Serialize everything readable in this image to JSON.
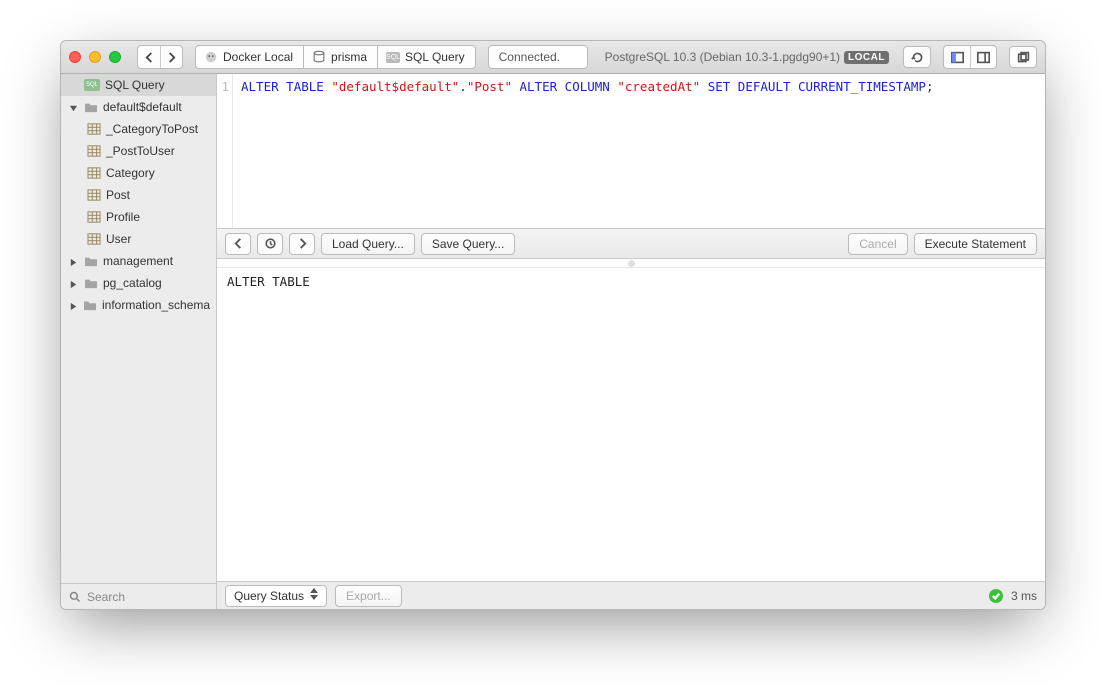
{
  "titlebar": {
    "connection_status": "Connected.",
    "db_version_prefix": "PostgreSQL 10.3 (Debian 10.3-1.pgdg90+1)",
    "local_badge": "LOCAL"
  },
  "breadcrumbs": [
    {
      "icon": "elephant",
      "label": "Docker Local"
    },
    {
      "icon": "db",
      "label": "prisma"
    },
    {
      "icon": "sql",
      "label": "SQL Query"
    }
  ],
  "sidebar": {
    "search_placeholder": "Search",
    "items": [
      {
        "kind": "sql",
        "label": "SQL Query",
        "depth": 1,
        "selected": true,
        "expandable": false
      },
      {
        "kind": "folder",
        "label": "default$default",
        "depth": 1,
        "selected": false,
        "expandable": true,
        "expanded": true
      },
      {
        "kind": "table",
        "label": "_CategoryToPost",
        "depth": 2
      },
      {
        "kind": "table",
        "label": "_PostToUser",
        "depth": 2
      },
      {
        "kind": "table",
        "label": "Category",
        "depth": 2
      },
      {
        "kind": "table",
        "label": "Post",
        "depth": 2
      },
      {
        "kind": "table",
        "label": "Profile",
        "depth": 2
      },
      {
        "kind": "table",
        "label": "User",
        "depth": 2
      },
      {
        "kind": "folder",
        "label": "management",
        "depth": 1,
        "expandable": true,
        "expanded": false
      },
      {
        "kind": "folder",
        "label": "pg_catalog",
        "depth": 1,
        "expandable": true,
        "expanded": false
      },
      {
        "kind": "folder",
        "label": "information_schema",
        "depth": 1,
        "expandable": true,
        "expanded": false
      }
    ]
  },
  "editor": {
    "line_number": "1",
    "sql_tokens": [
      {
        "t": "kw",
        "v": "ALTER"
      },
      {
        "t": "sp"
      },
      {
        "t": "kw",
        "v": "TABLE"
      },
      {
        "t": "sp"
      },
      {
        "t": "str",
        "v": "\"default$default\""
      },
      {
        "t": "punct",
        "v": "."
      },
      {
        "t": "str",
        "v": "\"Post\""
      },
      {
        "t": "sp"
      },
      {
        "t": "kw",
        "v": "ALTER"
      },
      {
        "t": "sp"
      },
      {
        "t": "kw",
        "v": "COLUMN"
      },
      {
        "t": "sp"
      },
      {
        "t": "str",
        "v": "\"createdAt\""
      },
      {
        "t": "sp"
      },
      {
        "t": "kw",
        "v": "SET"
      },
      {
        "t": "sp"
      },
      {
        "t": "kw",
        "v": "DEFAULT"
      },
      {
        "t": "sp"
      },
      {
        "t": "kw",
        "v": "CURRENT_TIMESTAMP"
      },
      {
        "t": "punct",
        "v": ";"
      }
    ]
  },
  "midbar": {
    "load_query": "Load Query...",
    "save_query": "Save Query...",
    "cancel": "Cancel",
    "execute": "Execute Statement"
  },
  "results": {
    "output": "ALTER TABLE"
  },
  "bottombar": {
    "status_popup": "Query Status",
    "export": "Export...",
    "elapsed": "3 ms"
  }
}
